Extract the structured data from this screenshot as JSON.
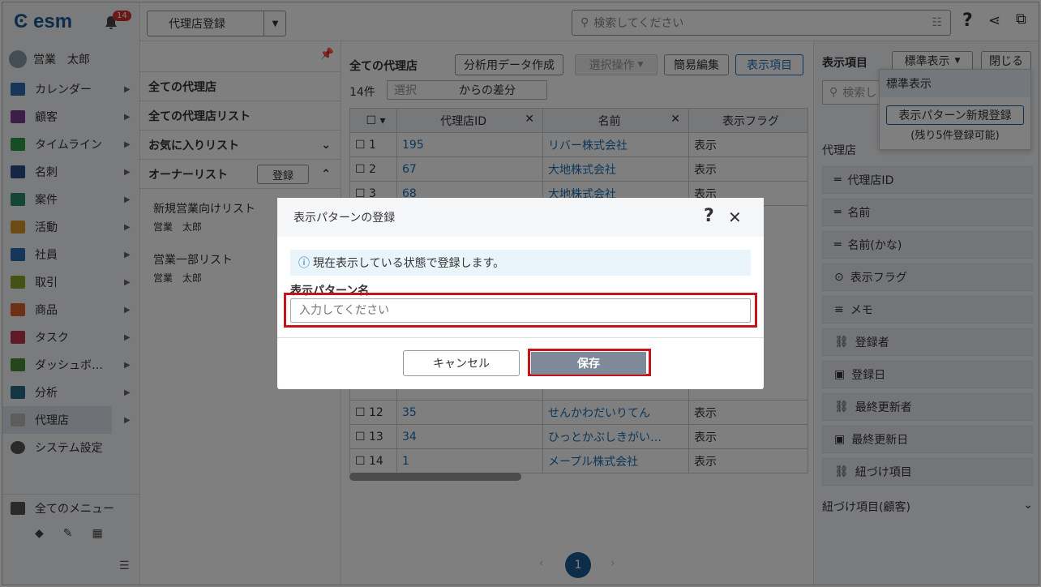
{
  "sidebar": {
    "logo": "esm",
    "notif_count": "14",
    "user_name": "営業　太郎",
    "items": [
      {
        "label": "カレンダー",
        "color": "#2c6fb5"
      },
      {
        "label": "顧客",
        "color": "#7a3d8c"
      },
      {
        "label": "タイムライン",
        "color": "#2e9b4b"
      },
      {
        "label": "名刺",
        "color": "#2c4f8a"
      },
      {
        "label": "案件",
        "color": "#2a8a6a"
      },
      {
        "label": "活動",
        "color": "#d8962a"
      },
      {
        "label": "社員",
        "color": "#2c6fb5"
      },
      {
        "label": "取引",
        "color": "#8aa32a"
      },
      {
        "label": "商品",
        "color": "#d8622a"
      },
      {
        "label": "タスク",
        "color": "#c0354c"
      },
      {
        "label": "ダッシュボ…",
        "color": "#4a8a3a"
      },
      {
        "label": "分析",
        "color": "#2a6a8a"
      },
      {
        "label": "代理店",
        "color": "#999999"
      },
      {
        "label": "システム設定",
        "color": "#555555"
      }
    ],
    "all_menu": "全てのメニュー"
  },
  "topbar": {
    "register_label": "代理店登録",
    "search_placeholder": "検索してください"
  },
  "lists": {
    "all_agencies": "全ての代理店",
    "all_agency_list": "全ての代理店リスト",
    "favorites": "お気に入りリスト",
    "owner_list": "オーナーリスト",
    "register_btn": "登録",
    "entries": [
      {
        "title": "新規営業向けリスト",
        "owner": "営業　太郎"
      },
      {
        "title": "営業一部リスト",
        "owner": "営業　太郎"
      }
    ]
  },
  "grid": {
    "title": "全ての代理店",
    "btn_export": "分析用データ作成",
    "btn_select_ops": "選択操作",
    "btn_quick_edit": "簡易編集",
    "btn_display_items": "表示項目",
    "count": "14件",
    "diff_select": "選択",
    "diff_label": "からの差分",
    "columns": [
      "代理店ID",
      "名前",
      "表示フラグ"
    ],
    "rows": [
      {
        "no": "1",
        "id": "195",
        "name": "リバー株式会社",
        "flag": "表示"
      },
      {
        "no": "2",
        "id": "67",
        "name": "大地株式会社",
        "flag": "表示"
      },
      {
        "no": "3",
        "id": "68",
        "name": "大地株式会社",
        "flag": "表示"
      },
      {
        "no": "12",
        "id": "35",
        "name": "せんかわだいりてん",
        "flag": "表示"
      },
      {
        "no": "13",
        "id": "34",
        "name": "ひっとかぶしきがい…",
        "flag": "表示"
      },
      {
        "no": "14",
        "id": "1",
        "name": "メープル株式会社",
        "flag": "表示"
      }
    ],
    "page": "1"
  },
  "rpanel": {
    "title": "表示項目",
    "pattern_select": "標準表示",
    "close_btn": "閉じる",
    "search_placeholder": "検索し",
    "section": "代理店",
    "items": [
      "代理店ID",
      "名前",
      "名前(かな)",
      "表示フラグ",
      "メモ",
      "登録者",
      "登録日",
      "最終更新者",
      "最終更新日",
      "紐づけ項目"
    ],
    "linked_section": "紐づけ項目(顧客)",
    "dropdown": {
      "option": "標準表示",
      "new_btn": "表示パターン新規登録",
      "remaining": "(残り5件登録可能)"
    }
  },
  "modal": {
    "title": "表示パターンの登録",
    "info": "現在表示している状態で登録します。",
    "field_label": "表示パターン名",
    "input_placeholder": "入力してください",
    "cancel": "キャンセル",
    "save": "保存"
  }
}
